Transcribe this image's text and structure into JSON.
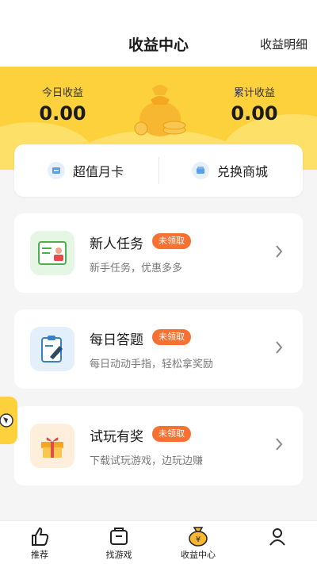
{
  "header": {
    "title": "收益中心",
    "detail_link": "收益明细"
  },
  "stats": {
    "today_label": "今日收益",
    "today_value": "0.00",
    "total_label": "累计收益",
    "total_value": "0.00"
  },
  "quick": {
    "month_card": "超值月卡",
    "exchange_shop": "兑换商城"
  },
  "tasks": [
    {
      "name": "新人任务",
      "badge": "未领取",
      "desc": "新手任务，优惠多多"
    },
    {
      "name": "每日答题",
      "badge": "未领取",
      "desc": "每日动动手指，轻松拿奖励"
    },
    {
      "name": "试玩有奖",
      "badge": "未领取",
      "desc": "下载试玩游戏，边玩边赚"
    }
  ],
  "nav": [
    {
      "label": "推荐"
    },
    {
      "label": "找游戏"
    },
    {
      "label": "收益中心"
    }
  ],
  "colors": {
    "brand_yellow": "#fcd13b",
    "badge_orange": "#f57233"
  }
}
